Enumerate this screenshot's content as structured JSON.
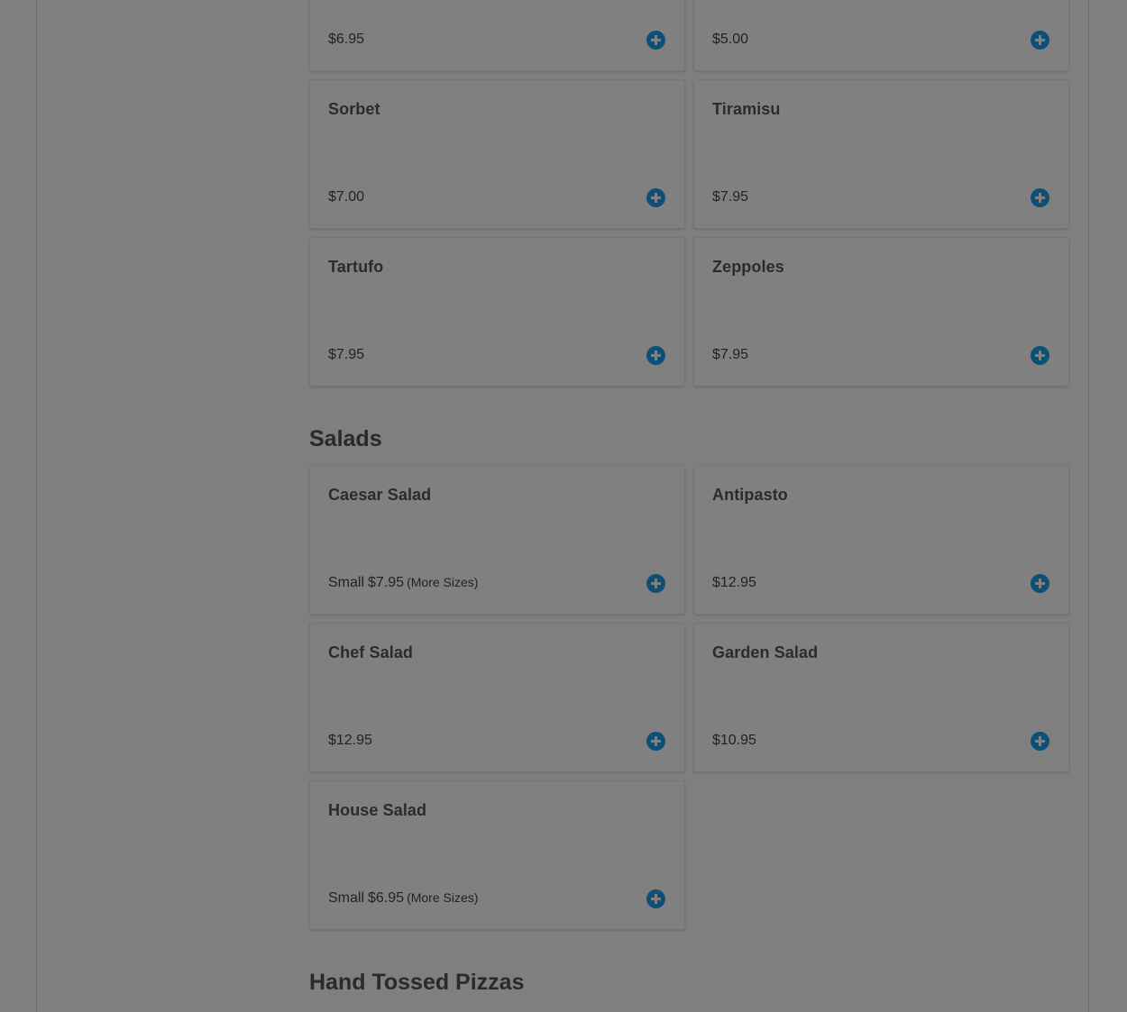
{
  "colors": {
    "overlay_background": "#7f7f7f",
    "add_button": "#0c4f77"
  },
  "sections": {
    "salads_title": "Salads",
    "hand_tossed_title": "Hand Tossed Pizzas"
  },
  "desserts": [
    {
      "name": "",
      "price": "$6.95"
    },
    {
      "name": "",
      "price": "$5.00"
    },
    {
      "name": "Sorbet",
      "price": "$7.00"
    },
    {
      "name": "Tiramisu",
      "price": "$7.95"
    },
    {
      "name": "Tartufo",
      "price": "$7.95"
    },
    {
      "name": "Zeppoles",
      "price": "$7.95"
    }
  ],
  "salads": [
    {
      "name": "Caesar Salad",
      "size": "Small",
      "price": "$7.95",
      "more": "(More Sizes)"
    },
    {
      "name": "Antipasto",
      "price": "$12.95"
    },
    {
      "name": "Chef Salad",
      "price": "$12.95"
    },
    {
      "name": "Garden Salad",
      "price": "$10.95"
    },
    {
      "name": "House Salad",
      "size": "Small",
      "price": "$6.95",
      "more": "(More Sizes)"
    }
  ],
  "icons": {
    "add": "plus-circle-icon"
  }
}
